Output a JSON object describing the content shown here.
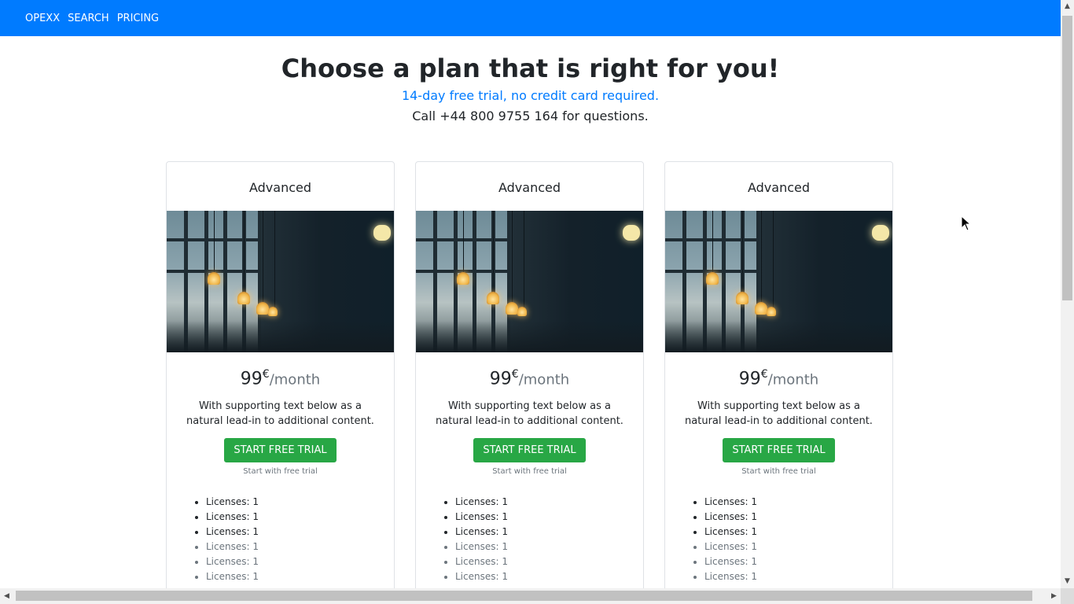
{
  "nav": {
    "items": [
      "OPEXX",
      "SEARCH",
      "PRICING"
    ]
  },
  "header": {
    "title": "Choose a plan that is right for you!",
    "subtitle": "14-day free trial, no credit card required.",
    "call": "Call +44 800 9755 164 for questions."
  },
  "plans": [
    {
      "name": "Advanced",
      "price": "99",
      "currency": "€",
      "period": "/month",
      "description": "With supporting text below as a natural lead-in to additional content.",
      "cta": "START FREE TRIAL",
      "hint": "Start with free trial",
      "features": [
        "Licenses: 1",
        "Licenses: 1",
        "Licenses: 1",
        "Licenses: 1",
        "Licenses: 1",
        "Licenses: 1"
      ]
    },
    {
      "name": "Advanced",
      "price": "99",
      "currency": "€",
      "period": "/month",
      "description": "With supporting text below as a natural lead-in to additional content.",
      "cta": "START FREE TRIAL",
      "hint": "Start with free trial",
      "features": [
        "Licenses: 1",
        "Licenses: 1",
        "Licenses: 1",
        "Licenses: 1",
        "Licenses: 1",
        "Licenses: 1"
      ]
    },
    {
      "name": "Advanced",
      "price": "99",
      "currency": "€",
      "period": "/month",
      "description": "With supporting text below as a natural lead-in to additional content.",
      "cta": "START FREE TRIAL",
      "hint": "Start with free trial",
      "features": [
        "Licenses: 1",
        "Licenses: 1",
        "Licenses: 1",
        "Licenses: 1",
        "Licenses: 1",
        "Licenses: 1"
      ]
    }
  ],
  "colors": {
    "navbar": "#007bff",
    "accent_text": "#007bff",
    "cta": "#28a745",
    "muted": "#6c757d"
  },
  "icons": {
    "scroll_up": "scroll-up-arrow-icon",
    "scroll_down": "scroll-down-arrow-icon",
    "scroll_left": "scroll-left-arrow-icon",
    "scroll_right": "scroll-right-arrow-icon",
    "cursor": "mouse-pointer-icon"
  }
}
